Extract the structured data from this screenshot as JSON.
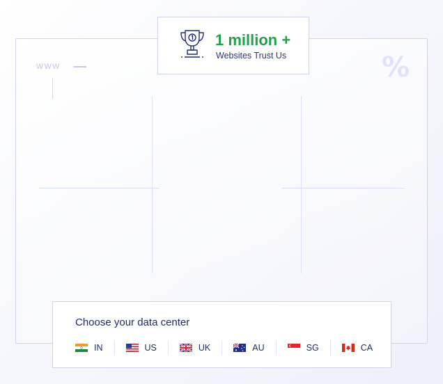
{
  "decor": {
    "www_text": "www",
    "percent_symbol": "%"
  },
  "badge": {
    "icon": "trophy-icon",
    "title": "1 million +",
    "subtitle": "Websites Trust Us",
    "title_color": "#1ea34a"
  },
  "data_center": {
    "title": "Choose your data center",
    "locations": [
      {
        "code": "IN",
        "flag": "india-flag-icon"
      },
      {
        "code": "US",
        "flag": "usa-flag-icon"
      },
      {
        "code": "UK",
        "flag": "uk-flag-icon"
      },
      {
        "code": "AU",
        "flag": "australia-flag-icon"
      },
      {
        "code": "SG",
        "flag": "singapore-flag-icon"
      },
      {
        "code": "CA",
        "flag": "canada-flag-icon"
      }
    ]
  },
  "colors": {
    "accent_green": "#1ea34a",
    "text_navy": "#1e2a6e",
    "border": "#cdd2f2"
  }
}
